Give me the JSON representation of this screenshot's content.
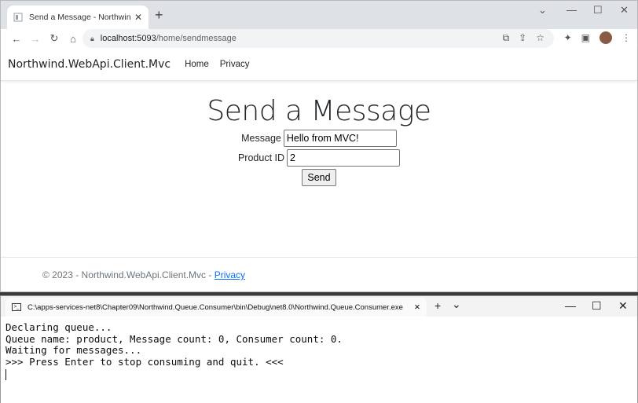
{
  "browser": {
    "tab_title": "Send a Message - Northwind.We",
    "tab_close": "✕",
    "new_tab": "+",
    "url_host": "localhost:5093",
    "url_path": "/home/sendmessage",
    "icons": [
      "back-icon",
      "forward-icon",
      "reload-icon",
      "home-icon",
      "lock-icon",
      "open-in-app-icon",
      "share-icon",
      "star-icon",
      "extensions-icon",
      "sidepanel-icon",
      "profile-avatar",
      "menu-icon"
    ]
  },
  "page": {
    "brand": "Northwind.WebApi.Client.Mvc",
    "nav": [
      "Home",
      "Privacy"
    ],
    "heading": "Send a Message",
    "message_label": "Message",
    "message_value": "Hello from MVC!",
    "product_label": "Product ID",
    "product_value": "2",
    "send_label": "Send",
    "footer_text": "© 2023 - Northwind.WebApi.Client.Mvc - ",
    "footer_link": "Privacy"
  },
  "console": {
    "tab_title": "C:\\apps-services-net8\\Chapter09\\Northwind.Queue.Consumer\\bin\\Debug\\net8.0\\Northwind.Queue.Consumer.exe",
    "tab_close": "✕",
    "new_tab": "+",
    "dropdown": "⌄",
    "lines": [
      "Declaring queue...",
      "Queue name: product, Message count: 0, Consumer count: 0.",
      "Waiting for messages...",
      ">>> Press Enter to stop consuming and quit. <<<"
    ]
  }
}
